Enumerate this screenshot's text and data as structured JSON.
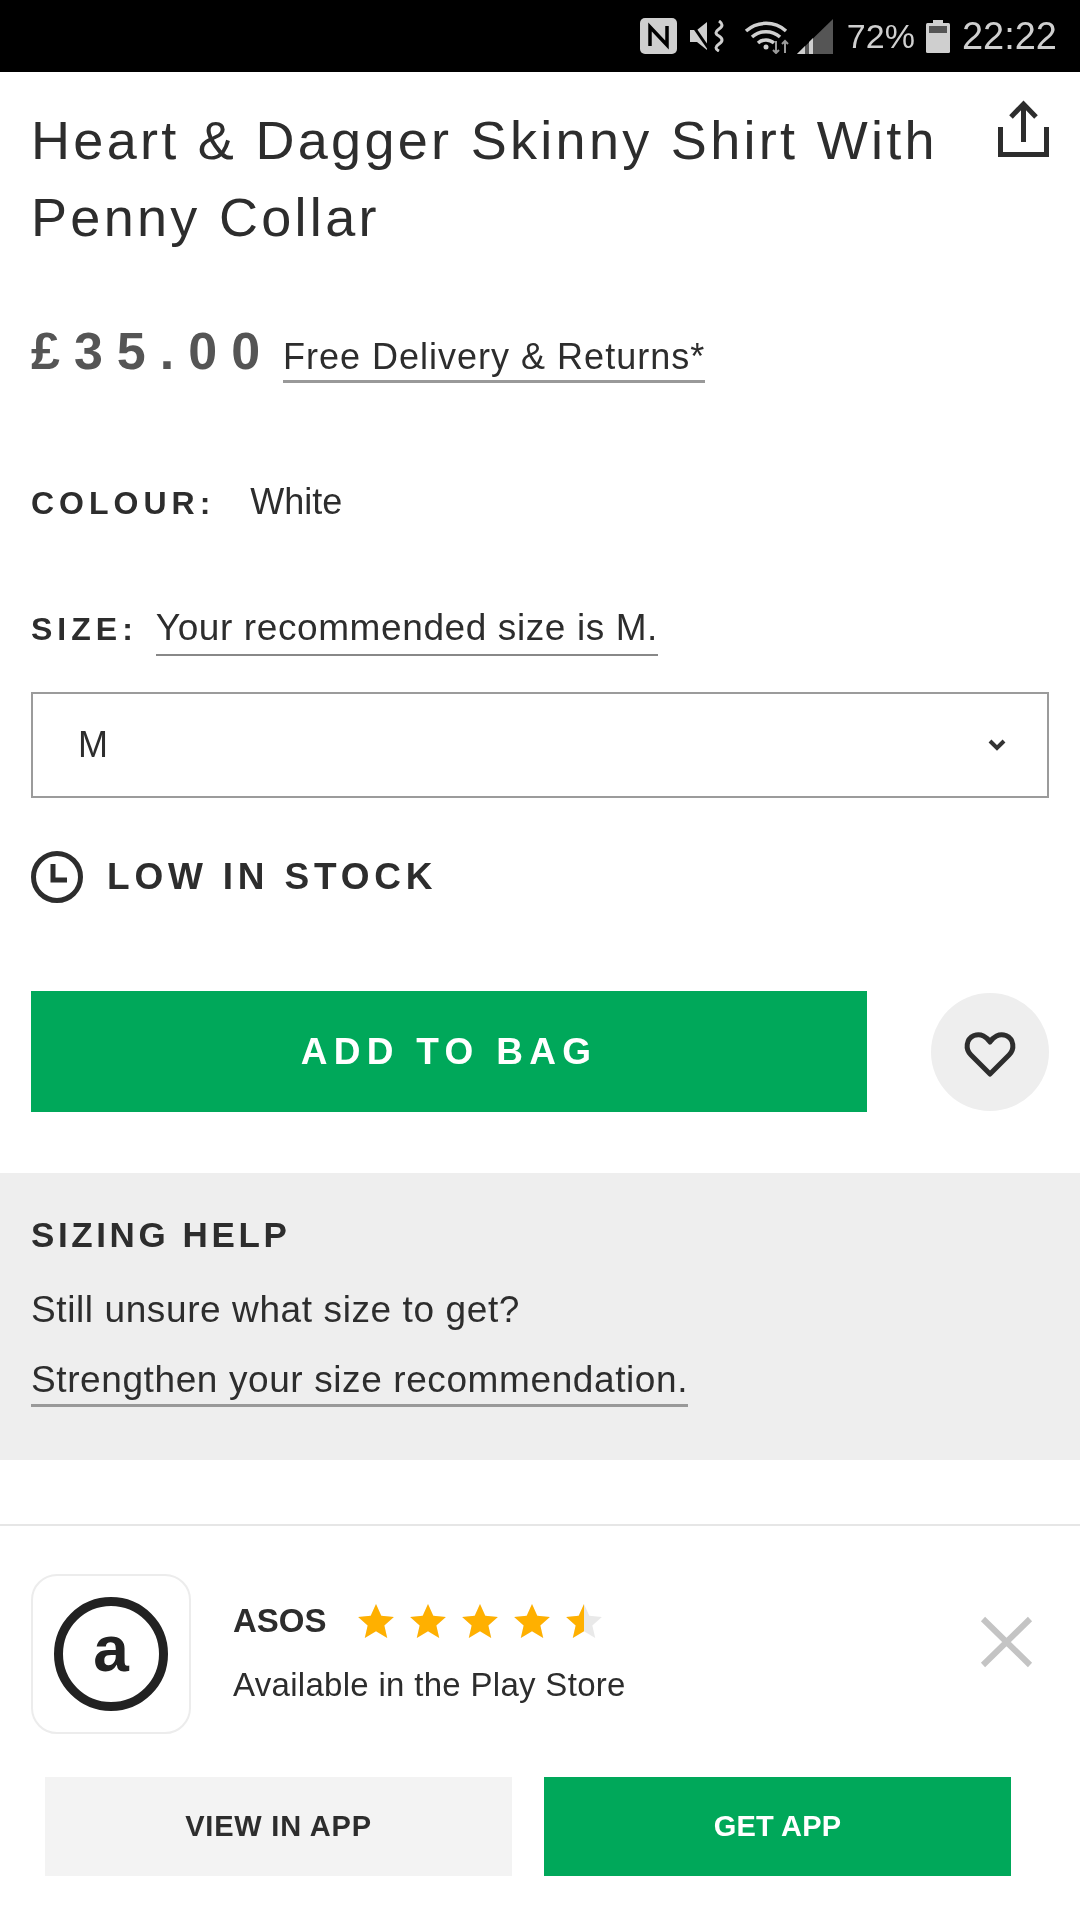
{
  "status_bar": {
    "battery": "72%",
    "time": "22:22"
  },
  "product": {
    "title": "Heart & Dagger Skinny Shirt With Penny Collar",
    "price": "£35.00",
    "delivery_link": "Free Delivery & Returns*"
  },
  "colour": {
    "label": "COLOUR:",
    "value": "White"
  },
  "size": {
    "label": "SIZE:",
    "recommendation_link": "Your recommended size is M.",
    "select_value": "M"
  },
  "stock": {
    "label": "LOW IN STOCK"
  },
  "add_to_bag": {
    "label": "ADD TO BAG"
  },
  "sizing_help": {
    "title": "SIZING HELP",
    "text": "Still unsure what size to get?",
    "link": "Strengthen your size recommendation."
  },
  "app_banner": {
    "logo_letter": "a",
    "name": "ASOS",
    "stars": 4.5,
    "subtitle": "Available in the Play Store",
    "buttons": [
      {
        "label": "VIEW IN APP",
        "kind": "secondary"
      },
      {
        "label": "GET APP",
        "kind": "primary"
      }
    ]
  }
}
